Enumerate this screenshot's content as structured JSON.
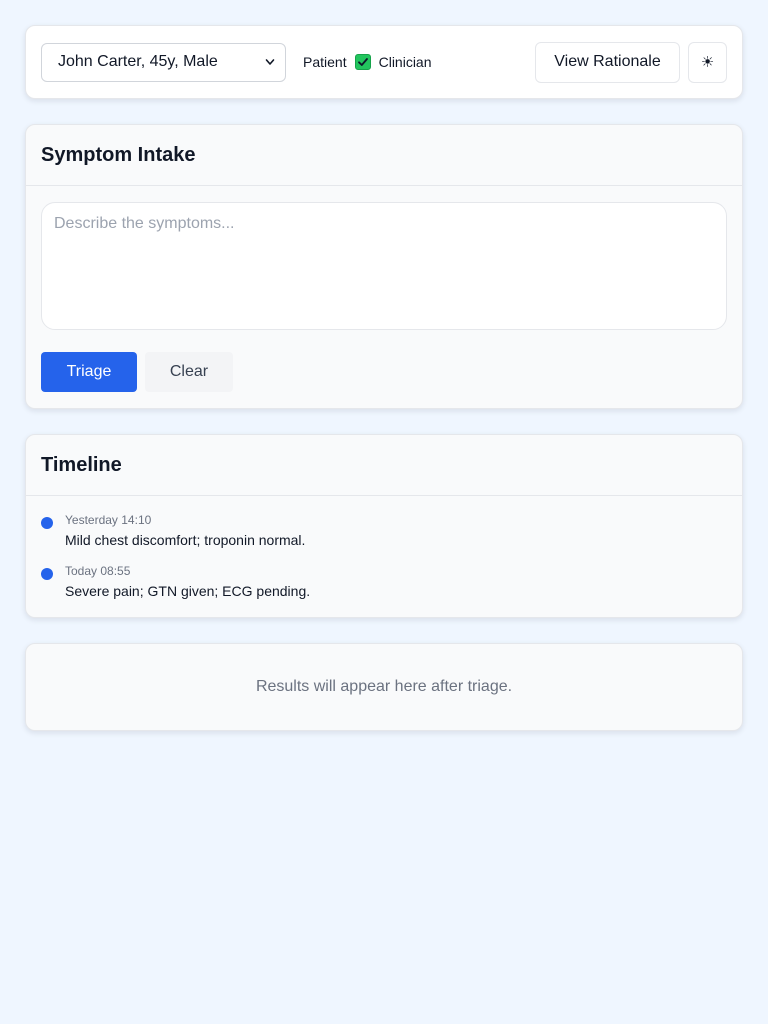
{
  "header": {
    "patient_selected": "John Carter, 45y, Male",
    "mode_left_label": "Patient",
    "mode_right_label": "Clinician",
    "clinician_mode_checked": true,
    "rationale_button": "View Rationale",
    "theme_icon": "sun-icon",
    "theme_glyph": "☀"
  },
  "intake": {
    "title": "Symptom Intake",
    "placeholder": "Describe the symptoms...",
    "value": "",
    "triage_button": "Triage",
    "clear_button": "Clear"
  },
  "timeline": {
    "title": "Timeline",
    "items": [
      {
        "time": "Yesterday 14:10",
        "text": "Mild chest discomfort; troponin normal."
      },
      {
        "time": "Today 08:55",
        "text": "Severe pain; GTN given; ECG pending."
      }
    ]
  },
  "results": {
    "empty_message": "Results will appear here after triage."
  },
  "colors": {
    "background": "#eff6ff",
    "primary": "#2563eb",
    "checkbox": "#22c55e",
    "muted_text": "#6b7280"
  }
}
